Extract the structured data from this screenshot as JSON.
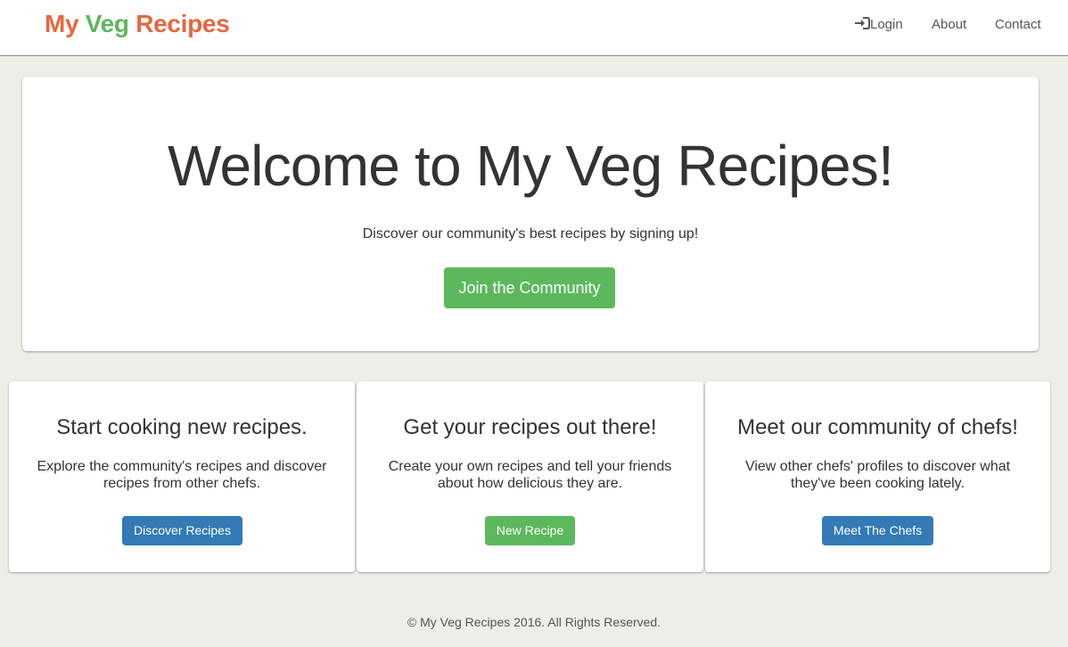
{
  "navbar": {
    "brand": {
      "word1": "My",
      "word2": "Veg",
      "word3": "Recipes"
    },
    "brand_colors": {
      "primary": "#e8663d",
      "secondary": "#5cb85c"
    },
    "links": {
      "login": {
        "label": "Login",
        "icon": "login-icon"
      },
      "about": "About",
      "contact": "Contact"
    }
  },
  "jumbotron": {
    "title": "Welcome to My Veg Recipes!",
    "subtitle": "Discover our community's best recipes by signing up!",
    "cta": "Join the Community"
  },
  "features": [
    {
      "title": "Start cooking new recipes.",
      "line1": "Explore the community's recipes and discover",
      "line2": "recipes from other chefs.",
      "button": "Discover Recipes",
      "button_color": "#337ab7"
    },
    {
      "title": "Get your recipes out there!",
      "line1": "Create your own recipes and tell your friends",
      "line2": "about how delicious they are.",
      "button": "New Recipe",
      "button_color": "#5cb85c"
    },
    {
      "title": "Meet our community of chefs!",
      "line1": "View other chefs' profiles to discover what",
      "line2": "they've been cooking lately.",
      "button": "Meet The Chefs",
      "button_color": "#337ab7"
    }
  ],
  "footer": {
    "text": "© My Veg Recipes 2016. All Rights Reserved."
  }
}
